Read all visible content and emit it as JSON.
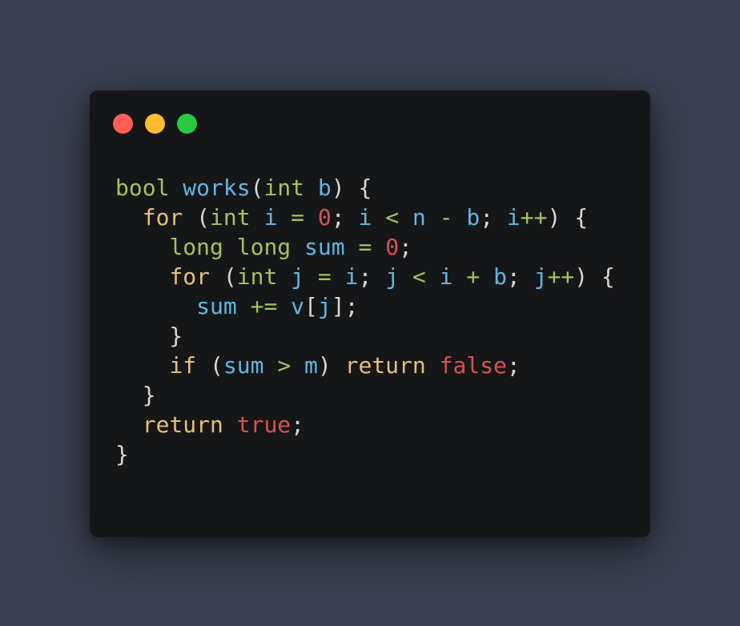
{
  "window": {
    "controls": [
      {
        "name": "close-dot",
        "color": "#fd5f57"
      },
      {
        "name": "minimize-dot",
        "color": "#febc2e"
      },
      {
        "name": "zoom-dot",
        "color": "#29c840"
      }
    ]
  },
  "colors": {
    "type": "#a4c261",
    "keyword": "#e5c07b",
    "identifier": "#62b6e0",
    "number": "#d55353",
    "operator": "#a4c261",
    "punct": "#d6d6d6",
    "boolean": "#d55353"
  },
  "code": {
    "lines": [
      [
        {
          "t": "bool",
          "k": "type"
        },
        {
          "t": " ",
          "k": "punct"
        },
        {
          "t": "works",
          "k": "identifier"
        },
        {
          "t": "(",
          "k": "punct"
        },
        {
          "t": "int",
          "k": "type"
        },
        {
          "t": " ",
          "k": "punct"
        },
        {
          "t": "b",
          "k": "identifier"
        },
        {
          "t": ") {",
          "k": "punct"
        }
      ],
      [
        {
          "t": "  ",
          "k": "punct"
        },
        {
          "t": "for",
          "k": "keyword"
        },
        {
          "t": " (",
          "k": "punct"
        },
        {
          "t": "int",
          "k": "type"
        },
        {
          "t": " ",
          "k": "punct"
        },
        {
          "t": "i",
          "k": "identifier"
        },
        {
          "t": " ",
          "k": "punct"
        },
        {
          "t": "=",
          "k": "operator"
        },
        {
          "t": " ",
          "k": "punct"
        },
        {
          "t": "0",
          "k": "number"
        },
        {
          "t": "; ",
          "k": "punct"
        },
        {
          "t": "i",
          "k": "identifier"
        },
        {
          "t": " ",
          "k": "punct"
        },
        {
          "t": "<",
          "k": "operator"
        },
        {
          "t": " ",
          "k": "punct"
        },
        {
          "t": "n",
          "k": "identifier"
        },
        {
          "t": " ",
          "k": "punct"
        },
        {
          "t": "-",
          "k": "operator"
        },
        {
          "t": " ",
          "k": "punct"
        },
        {
          "t": "b",
          "k": "identifier"
        },
        {
          "t": "; ",
          "k": "punct"
        },
        {
          "t": "i",
          "k": "identifier"
        },
        {
          "t": "++",
          "k": "operator"
        },
        {
          "t": ") {",
          "k": "punct"
        }
      ],
      [
        {
          "t": "    ",
          "k": "punct"
        },
        {
          "t": "long",
          "k": "type"
        },
        {
          "t": " ",
          "k": "punct"
        },
        {
          "t": "long",
          "k": "type"
        },
        {
          "t": " ",
          "k": "punct"
        },
        {
          "t": "sum",
          "k": "identifier"
        },
        {
          "t": " ",
          "k": "punct"
        },
        {
          "t": "=",
          "k": "operator"
        },
        {
          "t": " ",
          "k": "punct"
        },
        {
          "t": "0",
          "k": "number"
        },
        {
          "t": ";",
          "k": "punct"
        }
      ],
      [
        {
          "t": "    ",
          "k": "punct"
        },
        {
          "t": "for",
          "k": "keyword"
        },
        {
          "t": " (",
          "k": "punct"
        },
        {
          "t": "int",
          "k": "type"
        },
        {
          "t": " ",
          "k": "punct"
        },
        {
          "t": "j",
          "k": "identifier"
        },
        {
          "t": " ",
          "k": "punct"
        },
        {
          "t": "=",
          "k": "operator"
        },
        {
          "t": " ",
          "k": "punct"
        },
        {
          "t": "i",
          "k": "identifier"
        },
        {
          "t": "; ",
          "k": "punct"
        },
        {
          "t": "j",
          "k": "identifier"
        },
        {
          "t": " ",
          "k": "punct"
        },
        {
          "t": "<",
          "k": "operator"
        },
        {
          "t": " ",
          "k": "punct"
        },
        {
          "t": "i",
          "k": "identifier"
        },
        {
          "t": " ",
          "k": "punct"
        },
        {
          "t": "+",
          "k": "operator"
        },
        {
          "t": " ",
          "k": "punct"
        },
        {
          "t": "b",
          "k": "identifier"
        },
        {
          "t": "; ",
          "k": "punct"
        },
        {
          "t": "j",
          "k": "identifier"
        },
        {
          "t": "++",
          "k": "operator"
        },
        {
          "t": ") {",
          "k": "punct"
        }
      ],
      [
        {
          "t": "      ",
          "k": "punct"
        },
        {
          "t": "sum",
          "k": "identifier"
        },
        {
          "t": " ",
          "k": "punct"
        },
        {
          "t": "+=",
          "k": "operator"
        },
        {
          "t": " ",
          "k": "punct"
        },
        {
          "t": "v",
          "k": "identifier"
        },
        {
          "t": "[",
          "k": "punct"
        },
        {
          "t": "j",
          "k": "identifier"
        },
        {
          "t": "];",
          "k": "punct"
        }
      ],
      [
        {
          "t": "    }",
          "k": "punct"
        }
      ],
      [
        {
          "t": "    ",
          "k": "punct"
        },
        {
          "t": "if",
          "k": "keyword"
        },
        {
          "t": " (",
          "k": "punct"
        },
        {
          "t": "sum",
          "k": "identifier"
        },
        {
          "t": " ",
          "k": "punct"
        },
        {
          "t": ">",
          "k": "operator"
        },
        {
          "t": " ",
          "k": "punct"
        },
        {
          "t": "m",
          "k": "identifier"
        },
        {
          "t": ") ",
          "k": "punct"
        },
        {
          "t": "return",
          "k": "keyword"
        },
        {
          "t": " ",
          "k": "punct"
        },
        {
          "t": "false",
          "k": "boolean"
        },
        {
          "t": ";",
          "k": "punct"
        }
      ],
      [
        {
          "t": "  }",
          "k": "punct"
        }
      ],
      [
        {
          "t": "  ",
          "k": "punct"
        },
        {
          "t": "return",
          "k": "keyword"
        },
        {
          "t": " ",
          "k": "punct"
        },
        {
          "t": "true",
          "k": "boolean"
        },
        {
          "t": ";",
          "k": "punct"
        }
      ],
      [
        {
          "t": "}",
          "k": "punct"
        }
      ]
    ]
  }
}
